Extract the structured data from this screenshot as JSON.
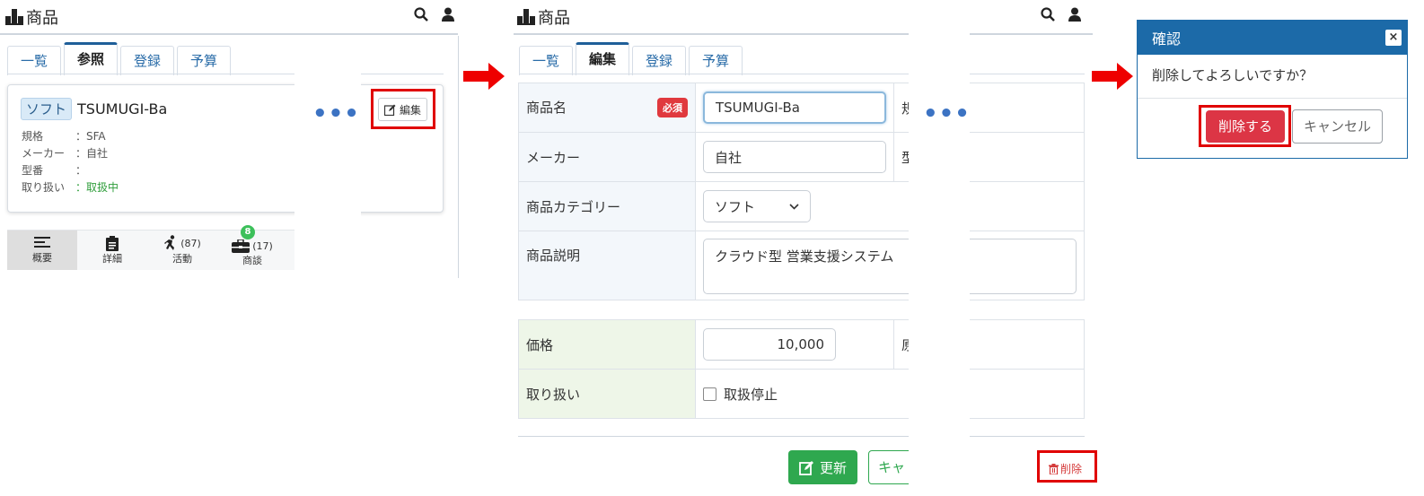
{
  "panel1": {
    "header_title": "商品",
    "tabs": [
      "一覧",
      "参照",
      "登録",
      "予算"
    ],
    "card": {
      "chip": "ソフト",
      "name": "TSUMUGI-Ba",
      "rows": [
        {
          "k": "規格",
          "v": "：SFA"
        },
        {
          "k": "メーカー",
          "v": "：自社"
        },
        {
          "k": "型番",
          "v": "："
        },
        {
          "k": "取り扱い",
          "v": "：取扱中"
        }
      ]
    },
    "edit_button": "編集",
    "bottom_nav": [
      {
        "label": "概要",
        "count": ""
      },
      {
        "label": "詳細",
        "count": ""
      },
      {
        "label": "活動",
        "count": "(87)"
      },
      {
        "label": "商談",
        "count": "(17)",
        "badge": "8"
      }
    ]
  },
  "panel2": {
    "header_title": "商品",
    "tabs": [
      "一覧",
      "編集",
      "登録",
      "予算"
    ],
    "fields": {
      "name_label": "商品名",
      "required": "必須",
      "name_value": "TSUMUGI-Ba",
      "spec_label_partial": "規",
      "maker_label": "メーカー",
      "maker_value": "自社",
      "model_label_partial": "型",
      "category_label": "商品カテゴリー",
      "category_value": "ソフト",
      "desc_label": "商品説明",
      "desc_value": "クラウド型 営業支援システム",
      "price_label": "価格",
      "price_value": "10,000",
      "cost_label_partial": "原",
      "handling_label": "取り扱い",
      "handling_checkbox": "取扱停止"
    },
    "update_button": "更新",
    "cancel_partial": "キャ",
    "delete_link": "削除"
  },
  "dialog": {
    "title": "確認",
    "close": "×",
    "message": "削除してよろしいですか？",
    "delete_button": "削除する",
    "cancel_button": "キャンセル"
  },
  "colors": {
    "accent": "#1c6aa8",
    "danger": "#dc3545",
    "success": "#2fa84f",
    "highlight": "#e00000"
  }
}
